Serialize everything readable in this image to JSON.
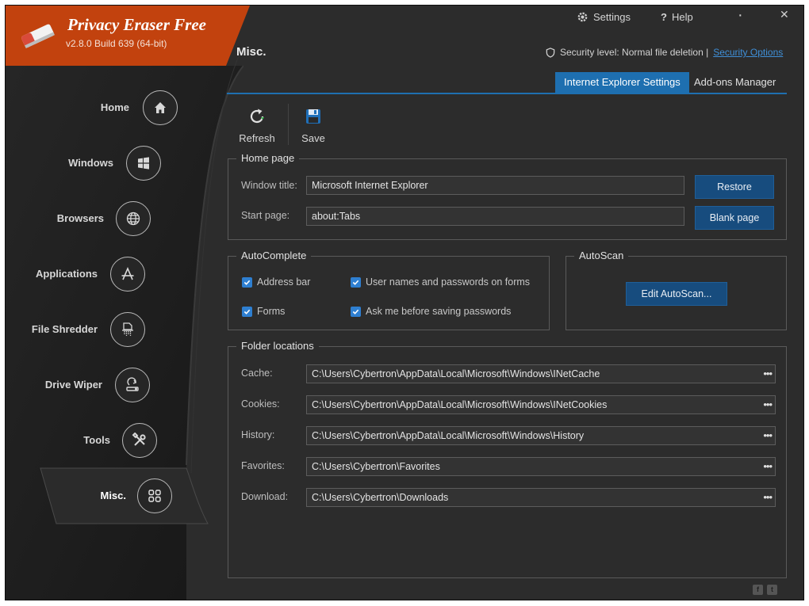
{
  "app": {
    "title": "Privacy Eraser Free",
    "version": "v2.8.0 Build 639 (64-bit)"
  },
  "topbar": {
    "settings": "Settings",
    "help": "Help",
    "minimize": "·",
    "close": "✕"
  },
  "page_title": "Misc.",
  "security": {
    "label": "Security level: Normal file deletion |",
    "link": "Security Options"
  },
  "nav": [
    {
      "label": "Home",
      "icon": "home-icon"
    },
    {
      "label": "Windows",
      "icon": "windows-icon"
    },
    {
      "label": "Browsers",
      "icon": "globe-icon"
    },
    {
      "label": "Applications",
      "icon": "applications-icon"
    },
    {
      "label": "File Shredder",
      "icon": "shredder-icon"
    },
    {
      "label": "Drive Wiper",
      "icon": "drive-wiper-icon"
    },
    {
      "label": "Tools",
      "icon": "tools-icon"
    },
    {
      "label": "Misc.",
      "icon": "grid-icon",
      "active": true
    }
  ],
  "tabs": [
    {
      "label": "Internet Explorer Settings",
      "active": true
    },
    {
      "label": "Add-ons Manager",
      "active": false
    }
  ],
  "toolbar": {
    "refresh": "Refresh",
    "save": "Save"
  },
  "home_page": {
    "title": "Home page",
    "window_title_label": "Window title:",
    "window_title_value": "Microsoft Internet Explorer",
    "start_page_label": "Start page:",
    "start_page_value": "about:Tabs",
    "restore": "Restore",
    "blank_page": "Blank page"
  },
  "autocomplete": {
    "title": "AutoComplete",
    "address_bar": "Address bar",
    "forms": "Forms",
    "user_names": "User names and passwords on forms",
    "ask_me": "Ask me before saving passwords"
  },
  "autoscan": {
    "title": "AutoScan",
    "button": "Edit AutoScan..."
  },
  "folders": {
    "title": "Folder locations",
    "browse": "•••",
    "rows": [
      {
        "label": "Cache:",
        "value": "C:\\Users\\Cybertron\\AppData\\Local\\Microsoft\\Windows\\INetCache"
      },
      {
        "label": "Cookies:",
        "value": "C:\\Users\\Cybertron\\AppData\\Local\\Microsoft\\Windows\\INetCookies"
      },
      {
        "label": "History:",
        "value": "C:\\Users\\Cybertron\\AppData\\Local\\Microsoft\\Windows\\History"
      },
      {
        "label": "Favorites:",
        "value": "C:\\Users\\Cybertron\\Favorites"
      },
      {
        "label": "Download:",
        "value": "C:\\Users\\Cybertron\\Downloads"
      }
    ]
  },
  "colors": {
    "brand": "#c2420e",
    "accent": "#1e6fb0",
    "panel": "#2c2c2c",
    "sidebar": "#1e1e1e"
  }
}
